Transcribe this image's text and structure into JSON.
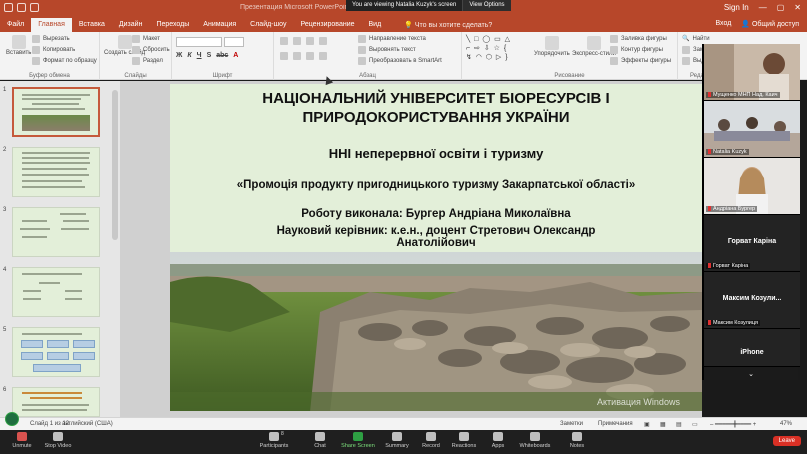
{
  "window": {
    "doc_title": "Презентация Microsoft PowerPoint",
    "signin": "Sign In",
    "zoom_banner": "You are viewing Natalia Kuzyk's screen",
    "view_options": "View Options"
  },
  "tabs": [
    "Файл",
    "Главная",
    "Вставка",
    "Дизайн",
    "Переходы",
    "Анимация",
    "Слайд-шоу",
    "Рецензирование",
    "Вид"
  ],
  "active_tab": "Главная",
  "tell_me": "Что вы хотите сделать?",
  "tabs_right": {
    "login": "Вход",
    "share": "Общий доступ"
  },
  "ribbon": {
    "paste": "Вставить",
    "cut": "Вырезать",
    "copy": "Копировать",
    "format_painter": "Формат по образцу",
    "clipboard_label": "Буфер обмена",
    "new_slide": "Создать слайд",
    "layout": "Макет",
    "reset": "Сбросить",
    "section": "Раздел",
    "slides_label": "Слайды",
    "font_label": "Шрифт",
    "text_direction": "Направление текста",
    "align_text": "Выровнять текст",
    "smartart": "Преобразовать в SmartArt",
    "paragraph_label": "Абзац",
    "arrange": "Упорядочить",
    "quick_styles": "Экспресс-стили",
    "shape_fill": "Заливка фигуры",
    "shape_outline": "Контур фигуры",
    "shape_effects": "Эффекты фигуры",
    "drawing_label": "Рисование",
    "find": "Найти",
    "replace": "Заменить",
    "select": "Выделить",
    "editing_label": "Редактир"
  },
  "slide": {
    "university": "НАЦІОНАЛЬНИЙ УНІВЕРСИТЕТ БІОРЕСУРСІВ І ПРИРОДОКОРИСТУВАННЯ УКРАЇНИ",
    "institute": "ННІ неперервної освіти і туризму",
    "topic": "«Промоція продукту пригодницького туризму Закарпатської області»",
    "author": "Роботу виконала: Бургер Андріана Миколаївна",
    "supervisor": "Науковий керівник: к.е.н., доцент Стретович Олександр Анатолійович"
  },
  "thumbnails": [
    "1",
    "2",
    "3",
    "4",
    "5",
    "6"
  ],
  "watermark": "Активация Windows",
  "participants": [
    {
      "name": "Мущенко МНП Над. Каич",
      "type": "video"
    },
    {
      "name": "Natalia Kuzyk",
      "type": "video"
    },
    {
      "name": "Андріана Бургер",
      "type": "video"
    },
    {
      "big": "Горват Каріна",
      "name": "Горват Каріна",
      "type": "name"
    },
    {
      "big": "Максим   Козули...",
      "name": "Максим Козулиця",
      "type": "name"
    },
    {
      "big": "iPhone",
      "name": "",
      "type": "name"
    }
  ],
  "gallery_more": "⌄",
  "status": {
    "slide_counter": "Слайд 1 из 12",
    "language": "английский (США)",
    "notes": "Заметки",
    "comments": "Примечания",
    "zoom": "47%"
  },
  "meeting": {
    "unmute": "Unmute",
    "stop_video": "Stop Video",
    "participants": "Participants",
    "participants_count": "8",
    "chat": "Chat",
    "share_screen": "Share Screen",
    "summary": "Summary",
    "record": "Record",
    "reactions": "Reactions",
    "apps": "Apps",
    "whiteboards": "Whiteboards",
    "notes": "Notes",
    "leave": "Leave"
  }
}
